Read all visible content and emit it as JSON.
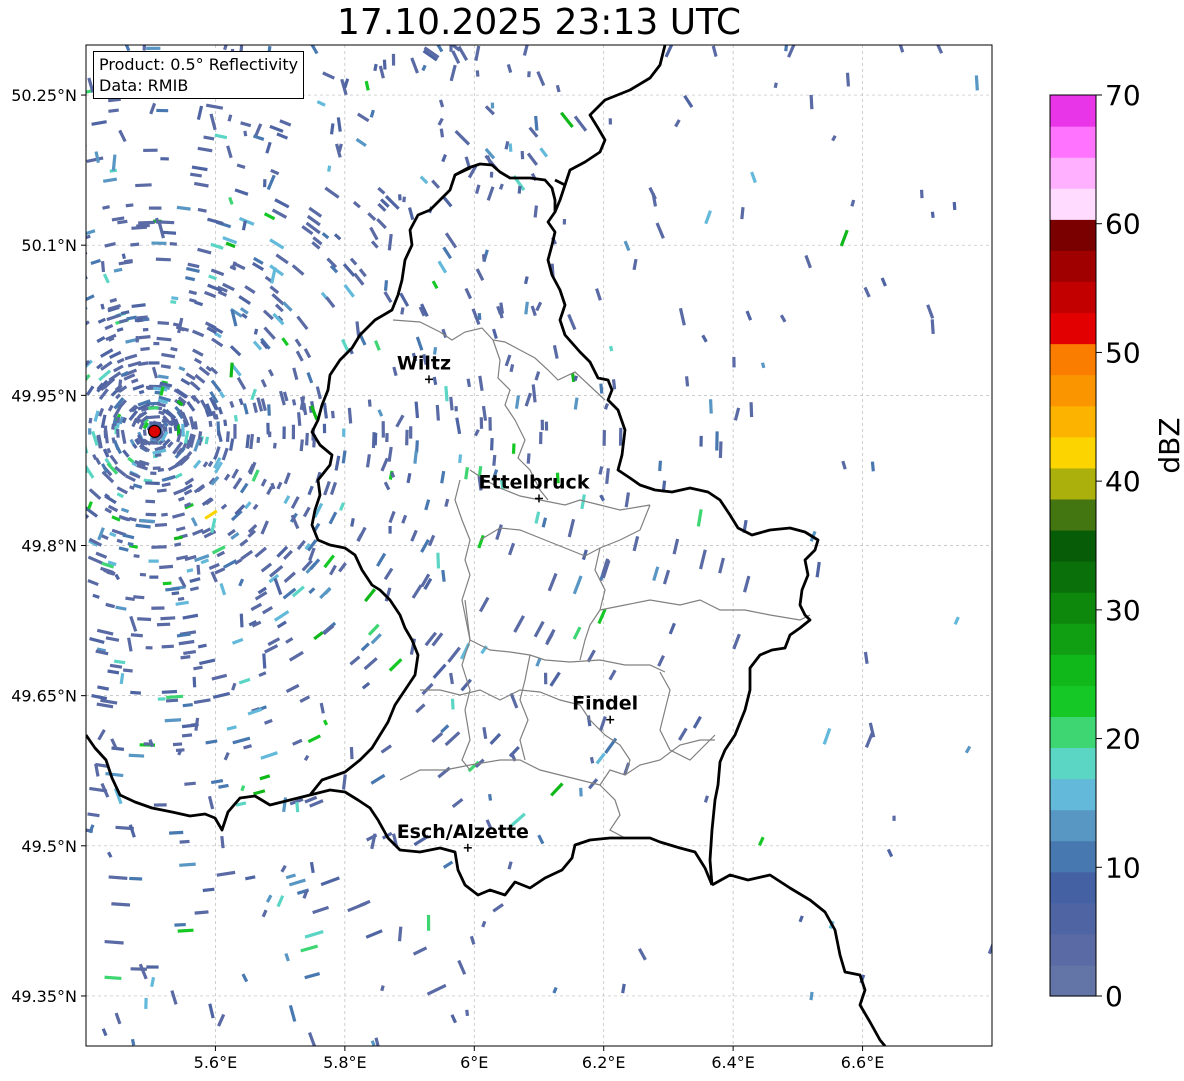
{
  "title": "17.10.2025 23:13 UTC",
  "info": {
    "product": "Product: 0.5° Reflectivity",
    "source": "Data: RMIB"
  },
  "map": {
    "lon_range": [
      5.4,
      6.8
    ],
    "lat_range": [
      49.3,
      50.3
    ],
    "lon_ticks": [
      {
        "value": 5.6,
        "label": "5.6°E"
      },
      {
        "value": 5.8,
        "label": "5.8°E"
      },
      {
        "value": 6.0,
        "label": "6°E"
      },
      {
        "value": 6.2,
        "label": "6.2°E"
      },
      {
        "value": 6.4,
        "label": "6.4°E"
      },
      {
        "value": 6.6,
        "label": "6.6°E"
      }
    ],
    "lat_ticks": [
      {
        "value": 50.25,
        "label": "50.25°N"
      },
      {
        "value": 50.1,
        "label": "50.1°N"
      },
      {
        "value": 49.95,
        "label": "49.95°N"
      },
      {
        "value": 49.8,
        "label": "49.8°N"
      },
      {
        "value": 49.65,
        "label": "49.65°N"
      },
      {
        "value": 49.5,
        "label": "49.5°N"
      },
      {
        "value": 49.35,
        "label": "49.35°N"
      }
    ],
    "cities": [
      {
        "name": "Wiltz",
        "lon": 5.93,
        "lat": 49.966
      },
      {
        "name": "Ettelbruck",
        "lon": 6.1,
        "lat": 49.847
      },
      {
        "name": "Findel",
        "lon": 6.21,
        "lat": 49.626
      },
      {
        "name": "Esch/Alzette",
        "lon": 5.99,
        "lat": 49.498
      }
    ],
    "radar_site": {
      "lon": 5.506,
      "lat": 49.914,
      "color": "#dd0000"
    },
    "colors": {
      "border": "#000000",
      "canton_border": "#808080",
      "grid": "#bbbbbb"
    }
  },
  "colorbar": {
    "label": "dBZ",
    "min": 0,
    "max": 70,
    "step": 2.5,
    "tick_values": [
      0,
      10,
      20,
      30,
      40,
      50,
      60,
      70
    ],
    "tick_labels": [
      "0",
      "10",
      "20",
      "30",
      "40",
      "50",
      "60",
      "70"
    ],
    "colors": [
      "#6374a6",
      "#5a6aa4",
      "#4f65a3",
      "#4461a4",
      "#4878b0",
      "#5897c4",
      "#62b9d9",
      "#5cd6c4",
      "#3dd672",
      "#15c825",
      "#11b81a",
      "#109f12",
      "#0e870d",
      "#0a700a",
      "#075c07",
      "#437510",
      "#acb00c",
      "#fcd500",
      "#fcb300",
      "#fa9500",
      "#fb7d00",
      "#e30000",
      "#c20000",
      "#a00000",
      "#7a0000",
      "#ffdcff",
      "#ffb1ff",
      "#ff73ff",
      "#e835e8"
    ]
  },
  "echo_palette": [
    "#5a6aa4",
    "#4f65a3",
    "#4878b0",
    "#5897c4",
    "#62b9d9",
    "#5cd6c4",
    "#3dd672",
    "#15c825",
    "#11b81a",
    "#fcd500",
    "#fb7d00"
  ]
}
